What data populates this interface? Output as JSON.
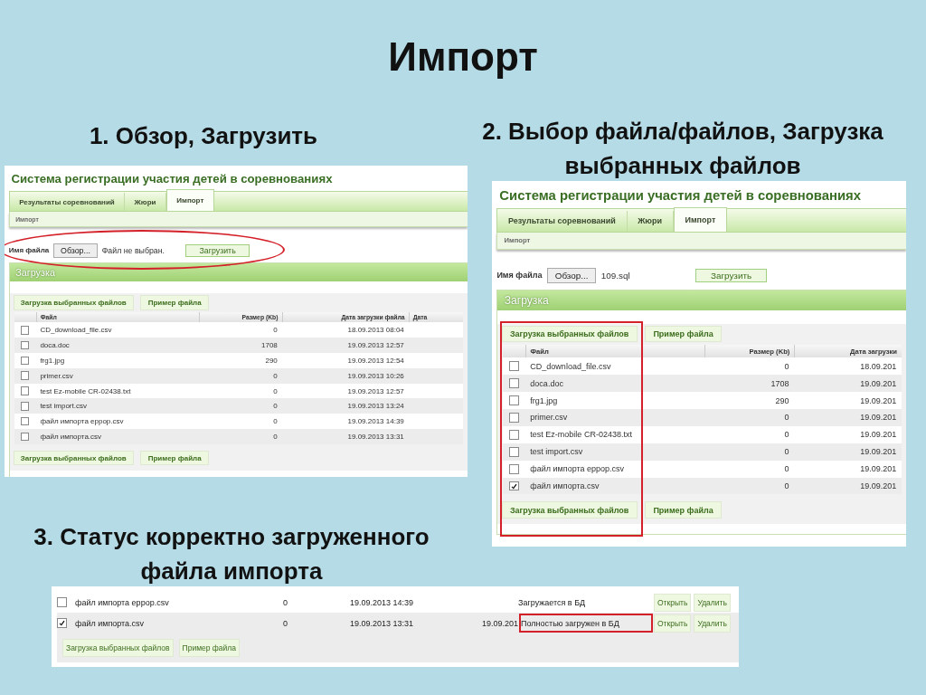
{
  "slide_title": "Импорт",
  "captions": [
    "1. Обзор, Загрузить",
    "2. Выбор файла/файлов, Загрузка выбранных файлов",
    "3. Статус корректно загруженного файла импорта"
  ],
  "screens": [
    {
      "file_row_circled": true,
      "checkboxes_framed": false,
      "app_title": "Система регистрации участия детей в соревнованиях",
      "tabs": [
        {
          "label": "Результаты соревнований",
          "selected": false
        },
        {
          "label": "Жюри",
          "selected": false
        },
        {
          "label": "Импорт",
          "selected": true
        }
      ],
      "breadcrumb": "Импорт",
      "file_label": "Имя файла",
      "browse_button": "Обзор...",
      "file_name": "Файл не выбран.",
      "upload_button": "Загрузить",
      "section_title": "Загрузка",
      "actions": [
        "Загрузка выбранных файлов",
        "Пример файла"
      ],
      "columns": [
        "Файл",
        "Размер (Kb)",
        "Дата загрузки файла",
        "Дата"
      ],
      "rows": [
        {
          "checked": false,
          "cells": [
            "CD_download_file.csv",
            "0",
            "18.09.2013 08:04"
          ]
        },
        {
          "checked": false,
          "cells": [
            "doca.doc",
            "1708",
            "19.09.2013 12:57"
          ]
        },
        {
          "checked": false,
          "cells": [
            "frg1.jpg",
            "290",
            "19.09.2013 12:54"
          ]
        },
        {
          "checked": false,
          "cells": [
            "primer.csv",
            "0",
            "19.09.2013 10:26"
          ]
        },
        {
          "checked": false,
          "cells": [
            "test Ez-mobile CR-02438.txt",
            "0",
            "19.09.2013 12:57"
          ]
        },
        {
          "checked": false,
          "cells": [
            "test import.csv",
            "0",
            "19.09.2013 13:24"
          ]
        },
        {
          "checked": false,
          "cells": [
            "файл импорта еррор.csv",
            "0",
            "19.09.2013 14:39"
          ]
        },
        {
          "checked": false,
          "cells": [
            "файл импорта.csv",
            "0",
            "19.09.2013 13:31"
          ]
        }
      ],
      "bottom_actions": [
        "Загрузка выбранных файлов",
        "Пример файла"
      ]
    },
    {
      "file_row_circled": false,
      "checkboxes_framed": true,
      "app_title": "Система регистрации участия детей в соревнованиях",
      "tabs": [
        {
          "label": "Результаты соревнований",
          "selected": false
        },
        {
          "label": "Жюри",
          "selected": false
        },
        {
          "label": "Импорт",
          "selected": true
        }
      ],
      "breadcrumb": "Импорт",
      "file_label": "Имя файла",
      "browse_button": "Обзор...",
      "file_name": "109.sql",
      "upload_button": "Загрузить",
      "section_title": "Загрузка",
      "actions": [
        "Загрузка выбранных файлов",
        "Пример файла"
      ],
      "columns": [
        "Файл",
        "Размер (Kb)",
        "Дата загрузки"
      ],
      "rows": [
        {
          "checked": false,
          "cells": [
            "CD_download_file.csv",
            "0",
            "18.09.201"
          ]
        },
        {
          "checked": false,
          "cells": [
            "doca.doc",
            "1708",
            "19.09.201"
          ]
        },
        {
          "checked": false,
          "cells": [
            "frg1.jpg",
            "290",
            "19.09.201"
          ]
        },
        {
          "checked": false,
          "cells": [
            "primer.csv",
            "0",
            "19.09.201"
          ]
        },
        {
          "checked": false,
          "cells": [
            "test Ez-mobile CR-02438.txt",
            "0",
            "19.09.201"
          ]
        },
        {
          "checked": false,
          "cells": [
            "test import.csv",
            "0",
            "19.09.201"
          ]
        },
        {
          "checked": false,
          "cells": [
            "файл импорта еррор.csv",
            "0",
            "19.09.201"
          ]
        },
        {
          "checked": true,
          "cells": [
            "файл импорта.csv",
            "0",
            "19.09.201"
          ]
        }
      ],
      "bottom_actions": [
        "Загрузка выбранных файлов",
        "Пример файла"
      ]
    }
  ],
  "status_screen": {
    "rows": [
      {
        "checked": false,
        "highlighted": false,
        "cells": [
          "файл импорта еррор.csv",
          "0",
          "19.09.2013 14:39",
          "",
          "Загружается в БД"
        ],
        "buttons": [
          "Открыть",
          "Удалить"
        ]
      },
      {
        "checked": true,
        "highlighted": true,
        "cells": [
          "файл импорта.csv",
          "0",
          "19.09.2013 13:31",
          "19.09.201",
          "Полностью загружен в БД"
        ],
        "buttons": [
          "Открыть",
          "Удалить"
        ]
      }
    ],
    "actions": [
      "Загрузка выбранных файлов",
      "Пример файла"
    ]
  }
}
